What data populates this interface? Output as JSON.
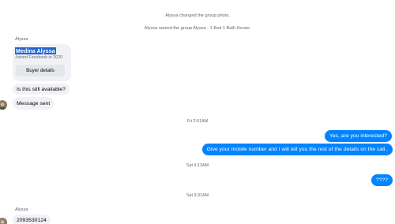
{
  "system_messages": [
    "Alyssa changed the group photo.",
    "Alyssa named the group Alyssa - 1 Bed 1 Bath House."
  ],
  "sender_name": "Alyssa",
  "buyer_card": {
    "name": "Medina Alyssa",
    "joined": "Joined Facebook in 2020",
    "button_label": "Buyer details"
  },
  "incoming_1": "Is this still available?",
  "incoming_2": "Message sent",
  "timestamps": [
    "Fri 2:51AM",
    "Sat 6:13AM",
    "Sat 9:31AM"
  ],
  "outgoing_1": "Yes, are you interested?",
  "outgoing_2": "Give your mobile number and I will tell you the rest of the details on the call..",
  "outgoing_3": "????",
  "incoming_3": "2093530124",
  "colors": {
    "outgoing_bubble": "#0084ff",
    "incoming_bubble": "#f0f2f5",
    "highlight": "#1f66d1"
  }
}
